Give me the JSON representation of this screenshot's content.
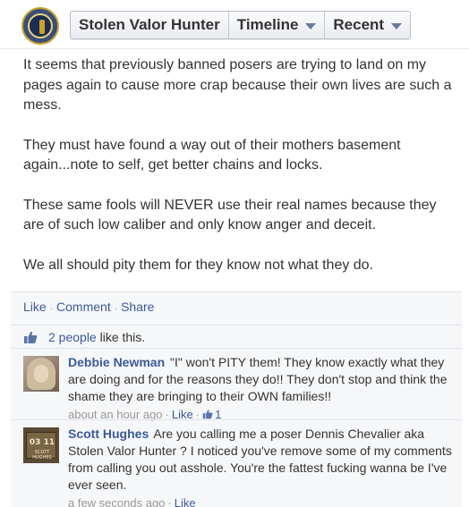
{
  "header": {
    "page_name": "Stolen Valor Hunter",
    "timeline_label": "Timeline",
    "recent_label": "Recent"
  },
  "post": {
    "paragraphs": [
      "It seems that previously banned posers are trying to land on my pages again to cause more crap because their own lives are such a mess.",
      "They must have found a way out of their mothers basement again...note to self, get better chains and locks.",
      "These same fools will NEVER use their real names because they are of such low caliber and only know anger and deceit.",
      "We all should pity them for they know not what they do."
    ]
  },
  "actions": {
    "like": "Like",
    "comment": "Comment",
    "share": "Share"
  },
  "likes": {
    "count_text": "2 people",
    "suffix": "like this."
  },
  "comments": [
    {
      "author": "Debbie Newman",
      "text": "\"I\" won't PITY them! They know exactly what they are doing and for the reasons they do!! They don't stop and think the shame they are bringing to their OWN families!!",
      "time": "about an hour ago",
      "like_label": "Like",
      "like_count": "1"
    },
    {
      "author": "Scott Hughes",
      "text": "Are you calling me a poser Dennis Chevalier aka Stolen Valor Hunter ? I noticed you've remove some of my comments from calling you out asshole. You're the fattest fucking wanna be I've ever seen.",
      "time": "a few seconds ago",
      "like_label": "Like",
      "avatar_number": "03 11",
      "avatar_caption": "SCOTT HUGHES"
    }
  ],
  "colors": {
    "link": "#3b5998",
    "panel": "#f6f7f9",
    "border": "#e1e2e6"
  }
}
